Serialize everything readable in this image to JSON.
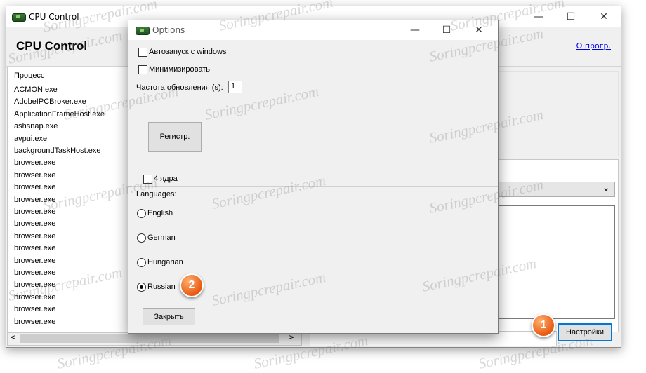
{
  "main_window": {
    "title": "CPU Control",
    "app_title": "CPU Control",
    "about_link": "О прогр.",
    "settings_button": "Настройки",
    "process_header": "Процесс",
    "processes": [
      "ACMON.exe",
      "AdobeIPCBroker.exe",
      "ApplicationFrameHost.exe",
      "ashsnap.exe",
      "avpui.exe",
      "backgroundTaskHost.exe",
      "browser.exe",
      "browser.exe",
      "browser.exe",
      "browser.exe",
      "browser.exe",
      "browser.exe",
      "browser.exe",
      "browser.exe",
      "browser.exe",
      "browser.exe",
      "browser.exe",
      "browser.exe",
      "browser.exe",
      "browser.exe"
    ],
    "scroll_left": "<",
    "scroll_right": ">",
    "minimize": "—",
    "maximize": "☐",
    "close": "✕",
    "dropdown_arrow": "⌄"
  },
  "options_dialog": {
    "title": "Options",
    "autostart_label": "Автозапуск с windows",
    "minimize_label": "Минимизировать",
    "refresh_label": "Частота обновления (s):",
    "refresh_value": "1",
    "register_button": "Регистр.",
    "four_cores_label": "4 ядра",
    "languages_label": "Languages:",
    "languages": [
      {
        "label": "English",
        "selected": false
      },
      {
        "label": "German",
        "selected": false
      },
      {
        "label": "Hungarian",
        "selected": false
      },
      {
        "label": "Russian",
        "selected": true
      }
    ],
    "close_button": "Закрыть",
    "minimize": "—",
    "maximize": "☐",
    "close": "✕"
  },
  "badges": {
    "step1": "1",
    "step2": "2"
  },
  "watermark": "Soringpcrepair.com",
  "colors": {
    "accent_border": "#0078d7",
    "badge": "#e85a12",
    "link": "#0000ee"
  }
}
